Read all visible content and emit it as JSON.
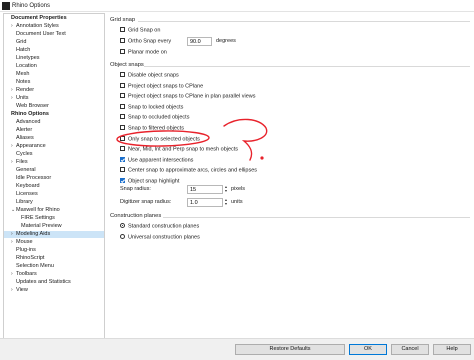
{
  "window": {
    "title": "Rhino Options"
  },
  "tree": {
    "items": [
      {
        "label": "Document Properties",
        "bold": true,
        "indent": 0,
        "chevron": ""
      },
      {
        "label": "Annotation Styles",
        "indent": 1,
        "chevron": ">"
      },
      {
        "label": "Document User Text",
        "indent": 1,
        "chevron": ""
      },
      {
        "label": "Grid",
        "indent": 1,
        "chevron": ""
      },
      {
        "label": "Hatch",
        "indent": 1,
        "chevron": ""
      },
      {
        "label": "Linetypes",
        "indent": 1,
        "chevron": ""
      },
      {
        "label": "Location",
        "indent": 1,
        "chevron": ""
      },
      {
        "label": "Mesh",
        "indent": 1,
        "chevron": ""
      },
      {
        "label": "Notes",
        "indent": 1,
        "chevron": ""
      },
      {
        "label": "Render",
        "indent": 1,
        "chevron": ">"
      },
      {
        "label": "Units",
        "indent": 1,
        "chevron": ">"
      },
      {
        "label": "Web Browser",
        "indent": 1,
        "chevron": ""
      },
      {
        "label": "Rhino Options",
        "bold": true,
        "indent": 0,
        "chevron": ""
      },
      {
        "label": "Advanced",
        "indent": 1,
        "chevron": ""
      },
      {
        "label": "Alerter",
        "indent": 1,
        "chevron": ""
      },
      {
        "label": "Aliases",
        "indent": 1,
        "chevron": ""
      },
      {
        "label": "Appearance",
        "indent": 1,
        "chevron": ">"
      },
      {
        "label": "Cycles",
        "indent": 1,
        "chevron": ""
      },
      {
        "label": "Files",
        "indent": 1,
        "chevron": ">"
      },
      {
        "label": "General",
        "indent": 1,
        "chevron": ""
      },
      {
        "label": "Idle Processor",
        "indent": 1,
        "chevron": ""
      },
      {
        "label": "Keyboard",
        "indent": 1,
        "chevron": ""
      },
      {
        "label": "Licenses",
        "indent": 1,
        "chevron": ""
      },
      {
        "label": "Library",
        "indent": 1,
        "chevron": ""
      },
      {
        "label": "Maxwell for Rhino",
        "indent": 1,
        "chevron": "v"
      },
      {
        "label": "FIRE Settings",
        "indent": 2,
        "chevron": ""
      },
      {
        "label": "Material Preview",
        "indent": 2,
        "chevron": ""
      },
      {
        "label": "Modeling Aids",
        "indent": 1,
        "chevron": ">",
        "selected": true
      },
      {
        "label": "Mouse",
        "indent": 1,
        "chevron": ">"
      },
      {
        "label": "Plug-ins",
        "indent": 1,
        "chevron": ""
      },
      {
        "label": "RhinoScript",
        "indent": 1,
        "chevron": ""
      },
      {
        "label": "Selection Menu",
        "indent": 1,
        "chevron": ""
      },
      {
        "label": "Toolbars",
        "indent": 1,
        "chevron": ">"
      },
      {
        "label": "Updates and Statistics",
        "indent": 1,
        "chevron": ""
      },
      {
        "label": "View",
        "indent": 1,
        "chevron": ">"
      }
    ]
  },
  "grid_snap": {
    "title": "Grid snap",
    "grid_snap_on": {
      "label": "Grid Snap on",
      "checked": false
    },
    "ortho_snap": {
      "label": "Ortho Snap every",
      "checked": false,
      "value": "90.0",
      "unit": "degrees"
    },
    "planar_mode": {
      "label": "Planar mode on",
      "checked": false
    }
  },
  "object_snaps": {
    "title": "Object snaps",
    "options": [
      {
        "label": "Disable object snaps",
        "checked": false
      },
      {
        "label": "Project object snaps to CPlane",
        "checked": false
      },
      {
        "label": "Project object snaps to CPlane in plan parallel views",
        "checked": false
      },
      {
        "label": "Snap to locked objects",
        "checked": false
      },
      {
        "label": "Snap to occluded objects",
        "checked": false
      },
      {
        "label": "Snap to filtered objects",
        "checked": false
      },
      {
        "label": "Only snap to selected objects",
        "checked": false
      },
      {
        "label": "Near, Mid, Int and Perp snap to mesh objects",
        "checked": false
      },
      {
        "label": "Use apparent intersections",
        "checked": true
      },
      {
        "label": "Center snap to approximate arcs, circles and ellipses",
        "checked": false
      },
      {
        "label": "Object snap highlight",
        "checked": true
      }
    ],
    "snap_radius": {
      "label": "Snap radius:",
      "value": "15",
      "unit": "pixels"
    },
    "digitizer_radius": {
      "label": "Digitizer snap radius:",
      "value": "1.0",
      "unit": "units"
    }
  },
  "construction_planes": {
    "title": "Construction planes",
    "options": [
      {
        "label": "Standard construction planes",
        "selected": true
      },
      {
        "label": "Universal construction planes",
        "selected": false
      }
    ]
  },
  "buttons": {
    "restore": "Restore Defaults",
    "ok": "OK",
    "cancel": "Cancel",
    "help": "Help"
  },
  "annotation": {
    "color": "#e8222b"
  }
}
